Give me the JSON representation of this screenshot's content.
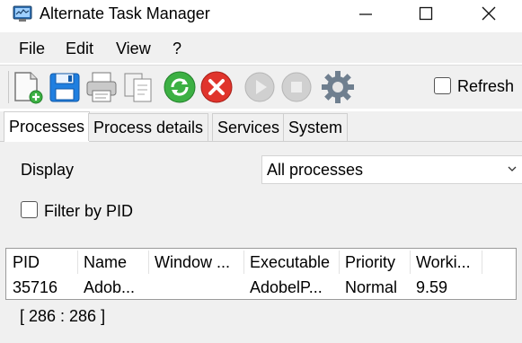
{
  "window": {
    "title": "Alternate Task Manager"
  },
  "menu": [
    "File",
    "Edit",
    "View",
    "?"
  ],
  "toolbar": {
    "buttons": [
      "new-process-icon",
      "save-icon",
      "print-icon",
      "copy-icon",
      "refresh-icon",
      "kill-icon",
      "resume-icon",
      "stop-icon",
      "settings-icon"
    ],
    "refresh_label": "Refresh",
    "refresh_checked": false
  },
  "tabs": [
    "Processes",
    "Process details",
    "Services",
    "System"
  ],
  "active_tab": "Processes",
  "filters": {
    "display_label": "Display",
    "display_value": "All processes",
    "filter_pid_label": "Filter by PID",
    "filter_pid_checked": false
  },
  "table": {
    "columns": [
      "PID",
      "Name",
      "Window ...",
      "Executable",
      "Priority",
      "Worki..."
    ],
    "rows": [
      [
        "35716",
        "Adob...",
        "",
        "AdobelP...",
        "Normal",
        "9.59"
      ]
    ]
  },
  "status": "[ 286 : 286 ]",
  "colors": {
    "refresh_green": "#3cb043",
    "kill_red": "#e0342c",
    "save_blue": "#1f7fe0"
  }
}
